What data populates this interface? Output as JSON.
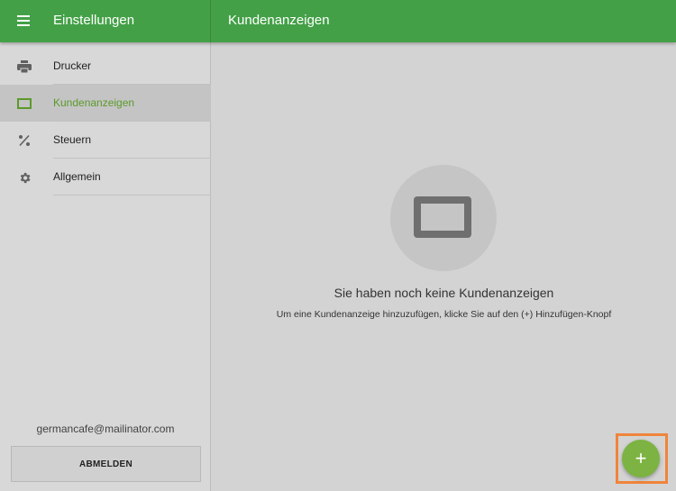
{
  "header": {
    "settings_title": "Einstellungen",
    "page_title": "Kundenanzeigen"
  },
  "sidebar": {
    "items": [
      {
        "label": "Drucker",
        "icon": "printer-icon",
        "active": false
      },
      {
        "label": "Kundenanzeigen",
        "icon": "display-icon",
        "active": true
      },
      {
        "label": "Steuern",
        "icon": "percent-icon",
        "active": false
      },
      {
        "label": "Allgemein",
        "icon": "gear-icon",
        "active": false
      }
    ],
    "email": "germancafe@mailinator.com",
    "logout_label": "ABMELDEN"
  },
  "main": {
    "empty_title": "Sie haben noch keine Kundenanzeigen",
    "empty_subtitle": "Um eine Kundenanzeige hinzuzufügen, klicke Sie auf den (+) Hinzufügen-Knopf",
    "add_symbol": "+"
  },
  "colors": {
    "appbar": "#43a047",
    "accent": "#7cb342",
    "active_text": "#5b9a2b",
    "highlight": "#f0843a"
  }
}
